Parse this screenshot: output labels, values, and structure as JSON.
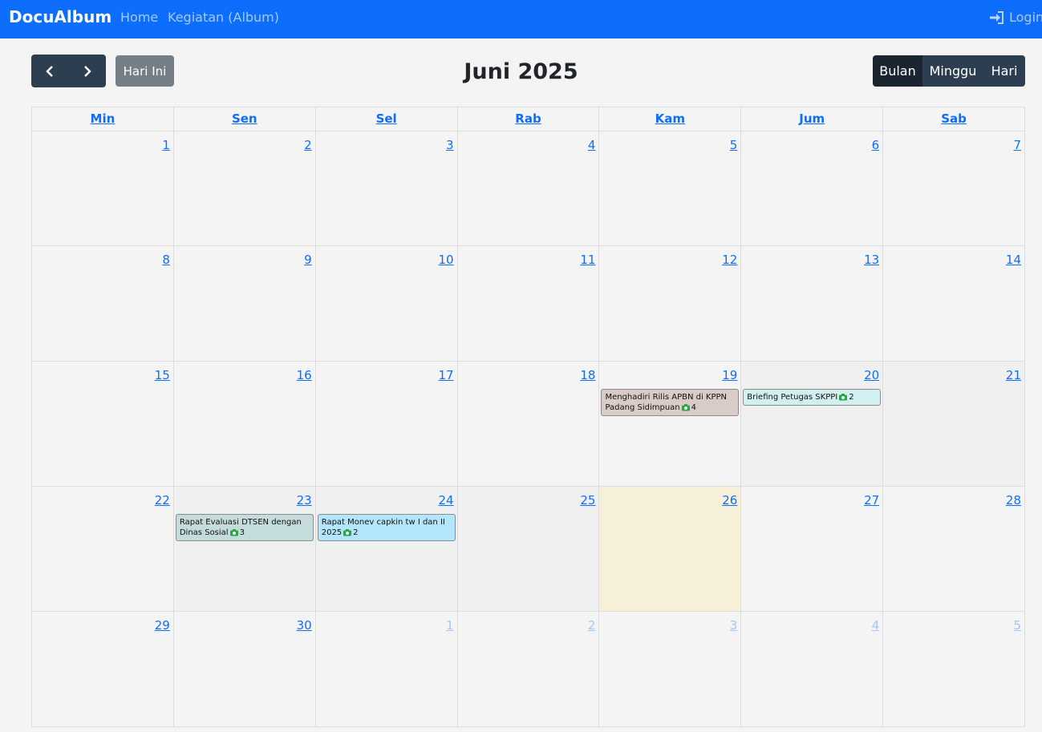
{
  "navbar": {
    "brand": "DocuAlbum",
    "links": [
      "Home",
      "Kegiatan (Album)"
    ],
    "login": "Login"
  },
  "toolbar": {
    "today": "Hari Ini",
    "title": "Juni 2025",
    "views": [
      "Bulan",
      "Minggu",
      "Hari"
    ],
    "active_view": "Bulan"
  },
  "calendar": {
    "weekdays": [
      "Min",
      "Sen",
      "Sel",
      "Rab",
      "Kam",
      "Jum",
      "Sab"
    ],
    "weeks": [
      [
        {
          "d": "1"
        },
        {
          "d": "2"
        },
        {
          "d": "3"
        },
        {
          "d": "4"
        },
        {
          "d": "5"
        },
        {
          "d": "6"
        },
        {
          "d": "7"
        }
      ],
      [
        {
          "d": "8"
        },
        {
          "d": "9"
        },
        {
          "d": "10"
        },
        {
          "d": "11"
        },
        {
          "d": "12"
        },
        {
          "d": "13"
        },
        {
          "d": "14"
        }
      ],
      [
        {
          "d": "15"
        },
        {
          "d": "16"
        },
        {
          "d": "17"
        },
        {
          "d": "18"
        },
        {
          "d": "19"
        },
        {
          "d": "20"
        },
        {
          "d": "21"
        }
      ],
      [
        {
          "d": "22"
        },
        {
          "d": "23"
        },
        {
          "d": "24"
        },
        {
          "d": "25"
        },
        {
          "d": "26"
        },
        {
          "d": "27"
        },
        {
          "d": "28"
        }
      ],
      [
        {
          "d": "29"
        },
        {
          "d": "30"
        },
        {
          "d": "1",
          "other": true
        },
        {
          "d": "2",
          "other": true
        },
        {
          "d": "3",
          "other": true
        },
        {
          "d": "4",
          "other": true
        },
        {
          "d": "5",
          "other": true
        }
      ]
    ],
    "today": {
      "week": 3,
      "day": 4
    },
    "events": [
      {
        "week": 2,
        "day": 4,
        "title": "Menghadiri Rilis APBN di KPPN Padang Sidimpuan",
        "photos": "4",
        "color": "#d9ccc8"
      },
      {
        "week": 2,
        "day": 5,
        "title": "Briefing Petugas SKPPI",
        "photos": "2",
        "color": "#d2f0f0"
      },
      {
        "week": 3,
        "day": 1,
        "title": "Rapat Evaluasi DTSEN dengan Dinas Sosial",
        "photos": "3",
        "color": "#c4dcdc"
      },
      {
        "week": 3,
        "day": 2,
        "title": "Rapat Monev capkin tw I dan II 2025",
        "photos": "2",
        "color": "#b3e5fc"
      }
    ],
    "camera_icon_color": "#28a745"
  }
}
